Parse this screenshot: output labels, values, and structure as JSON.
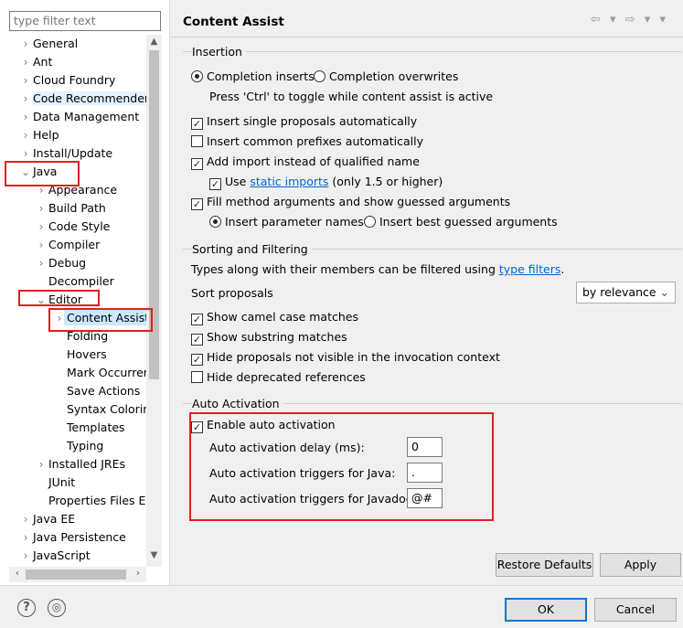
{
  "filter": {
    "placeholder": "type filter text"
  },
  "tree": {
    "items": [
      {
        "label": "General",
        "chev": ">"
      },
      {
        "label": "Ant",
        "chev": ">"
      },
      {
        "label": "Cloud Foundry",
        "chev": ">"
      },
      {
        "label": "Code Recommenders",
        "chev": ">"
      },
      {
        "label": "Data Management",
        "chev": ">"
      },
      {
        "label": "Help",
        "chev": ">"
      },
      {
        "label": "Install/Update",
        "chev": ">"
      },
      {
        "label": "Java",
        "chev": "v"
      },
      {
        "label": "Appearance",
        "chev": ">"
      },
      {
        "label": "Build Path",
        "chev": ">"
      },
      {
        "label": "Code Style",
        "chev": ">"
      },
      {
        "label": "Compiler",
        "chev": ">"
      },
      {
        "label": "Debug",
        "chev": ">"
      },
      {
        "label": "Decompiler",
        "chev": ""
      },
      {
        "label": "Editor",
        "chev": "v"
      },
      {
        "label": "Content Assist",
        "chev": ">"
      },
      {
        "label": "Folding",
        "chev": ""
      },
      {
        "label": "Hovers",
        "chev": ""
      },
      {
        "label": "Mark Occurren",
        "chev": ""
      },
      {
        "label": "Save Actions",
        "chev": ""
      },
      {
        "label": "Syntax Coloring",
        "chev": ""
      },
      {
        "label": "Templates",
        "chev": ""
      },
      {
        "label": "Typing",
        "chev": ""
      },
      {
        "label": "Installed JREs",
        "chev": ">"
      },
      {
        "label": "JUnit",
        "chev": ""
      },
      {
        "label": "Properties Files Ed",
        "chev": ""
      },
      {
        "label": "Java EE",
        "chev": ">"
      },
      {
        "label": "Java Persistence",
        "chev": ">"
      },
      {
        "label": "JavaScript",
        "chev": ">"
      }
    ]
  },
  "header": {
    "title": "Content Assist",
    "nav": "⇦ ▾ ⇨ ▾ ▾"
  },
  "insertion": {
    "label": "Insertion",
    "radio_completion_inserts": "Completion inserts",
    "radio_completion_overwrites": "Completion overwrites",
    "toggle_hint": "Press 'Ctrl' to toggle while content assist is active",
    "cb_single_proposals": "Insert single proposals automatically",
    "cb_common_prefixes": "Insert common prefixes automatically",
    "cb_add_import": "Add import instead of qualified name",
    "cb_static_use": "Use",
    "cb_static_link": "static imports",
    "cb_static_suffix": "(only 1.5 or higher)",
    "cb_fill_args": "Fill method arguments and show guessed arguments",
    "radio_param_names": "Insert parameter names",
    "radio_best_guessed": "Insert best guessed arguments"
  },
  "sorting": {
    "label": "Sorting and Filtering",
    "types_text": "Types along with their members can be filtered using",
    "type_filters_link": "type filters",
    "period": ".",
    "sort_label": "Sort proposals",
    "sort_value": "by relevance",
    "cb_camel": "Show camel case matches",
    "cb_substring": "Show substring matches",
    "cb_hide_invisible": "Hide proposals not visible in the invocation context",
    "cb_hide_deprecated": "Hide deprecated references"
  },
  "auto": {
    "label": "Auto Activation",
    "cb_enable": "Enable auto activation",
    "delay_label": "Auto activation delay (ms):",
    "delay_value": "0",
    "java_label": "Auto activation triggers for Java:",
    "java_value": ".",
    "javadoc_label": "Auto activation triggers for Javadoc:",
    "javadoc_value": "@#"
  },
  "buttons": {
    "restore": "Restore Defaults",
    "apply": "Apply",
    "ok": "OK",
    "cancel": "Cancel"
  },
  "icons": {
    "help": "?",
    "link": "◎"
  }
}
